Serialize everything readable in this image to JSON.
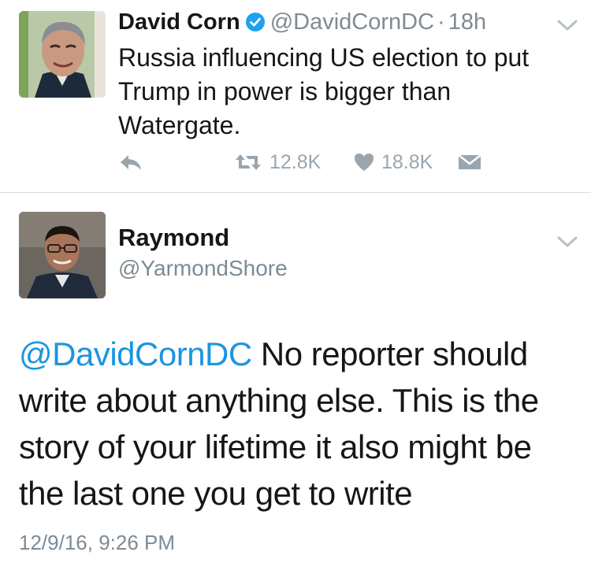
{
  "tweet1": {
    "author_name": "David Corn",
    "author_handle": "@DavidCornDC",
    "separator": "·",
    "time": "18h",
    "text": "Russia influencing US election to put Trump in power is bigger than Watergate.",
    "retweets": "12.8K",
    "likes": "18.8K",
    "verified_color": "#1da1f2"
  },
  "tweet2": {
    "author_name": "Raymond",
    "author_handle": "@YarmondShore",
    "mention": "@DavidCornDC",
    "text": " No reporter should write about anything else. This is the story of your lifetime it also might be the last one you get to write",
    "timestamp": "12/9/16, 9:26 PM"
  },
  "colors": {
    "link": "#1b95e0",
    "muted": "#7d8b95",
    "icon": "#9aa6ae",
    "divider": "#d6dde2"
  }
}
